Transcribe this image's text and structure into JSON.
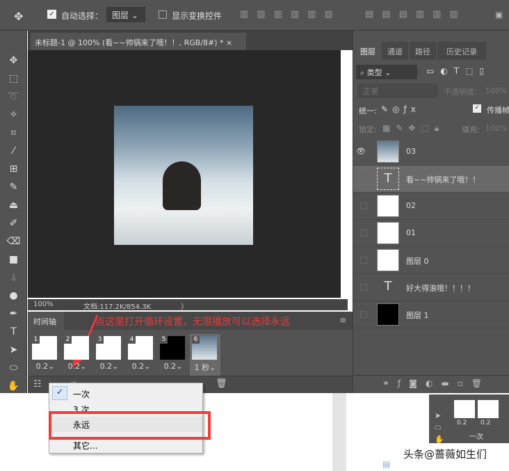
{
  "toolbar": {
    "auto_select_label": "自动选择：",
    "auto_select_value": "图层",
    "show_transform_label": "显示变换控件"
  },
  "document": {
    "tab_title": "未标题-1 @ 100% (看~~帅锅来了哦！！, RGB/8#) *",
    "close": "×",
    "zoom": "100%",
    "doc_size": "文档:117.2K/854.3K",
    "arrow": "〉"
  },
  "timeline": {
    "tab": "时间轴",
    "annotation": "点这里打开循环设置，无限播放可以选择永远",
    "frames": [
      {
        "n": "1",
        "delay": "0.2"
      },
      {
        "n": "2",
        "delay": "0.2"
      },
      {
        "n": "3",
        "delay": "0.2"
      },
      {
        "n": "4",
        "delay": "0.2"
      },
      {
        "n": "5",
        "delay": "0.2"
      },
      {
        "n": "6",
        "delay": "1 秒"
      }
    ],
    "loop_value": "一次"
  },
  "loop_menu": {
    "items": [
      "一次",
      "3 次",
      "永远",
      "其它..."
    ],
    "checked": "一次",
    "highlight": "永远"
  },
  "layers_panel": {
    "tabs": [
      "图层",
      "通道",
      "路径",
      "历史记录"
    ],
    "filter": "类型",
    "blend": "正常",
    "opacity_label": "不透明度:",
    "opacity": "100%",
    "unify_label": "统一:",
    "propagate_label": "传播帧",
    "lock_label": "锁定:",
    "fill_label": "填充:",
    "fill": "100%",
    "layers": [
      {
        "name": "03",
        "visible": true,
        "kind": "smart"
      },
      {
        "name": "看~~帅锅来了哦！！",
        "visible": false,
        "kind": "text"
      },
      {
        "name": "02",
        "visible": false,
        "kind": "smart"
      },
      {
        "name": "01",
        "visible": false,
        "kind": "smart"
      },
      {
        "name": "图层 0",
        "visible": false,
        "kind": "white"
      },
      {
        "name": "好大得浪哦！！！！",
        "visible": false,
        "kind": "text"
      },
      {
        "name": "图层 1",
        "visible": false,
        "kind": "black"
      }
    ]
  },
  "mini": {
    "delays": [
      "0.2",
      "0.2"
    ],
    "loop": "一次"
  },
  "watermark": "头条@蔷薇如生们"
}
